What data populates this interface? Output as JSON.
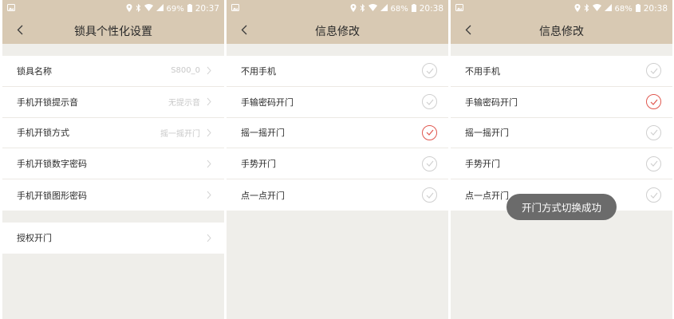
{
  "status_left": [
    {
      "battery": "69%",
      "time": "20:37"
    },
    {
      "battery": "68%",
      "time": "20:38"
    },
    {
      "battery": "68%",
      "time": "20:38"
    }
  ],
  "screen1": {
    "title": "锁具个性化设置",
    "items": [
      {
        "label": "锁具名称",
        "value": "S800_0"
      },
      {
        "label": "手机开锁提示音",
        "value": "无提示音"
      },
      {
        "label": "手机开锁方式",
        "value": "摇一摇开门"
      },
      {
        "label": "手机开锁数字密码",
        "value": ""
      },
      {
        "label": "手机开锁图形密码",
        "value": ""
      }
    ],
    "items2": [
      {
        "label": "授权开门",
        "value": ""
      }
    ]
  },
  "screen2": {
    "title": "信息修改",
    "items": [
      {
        "label": "不用手机",
        "checked": false
      },
      {
        "label": "手输密码开门",
        "checked": false
      },
      {
        "label": "摇一摇开门",
        "checked": true
      },
      {
        "label": "手势开门",
        "checked": false
      },
      {
        "label": "点一点开门",
        "checked": false
      }
    ]
  },
  "screen3": {
    "title": "信息修改",
    "items": [
      {
        "label": "不用手机",
        "checked": false
      },
      {
        "label": "手输密码开门",
        "checked": true
      },
      {
        "label": "摇一摇开门",
        "checked": false
      },
      {
        "label": "手势开门",
        "checked": false
      },
      {
        "label": "点一点开门",
        "checked": false
      }
    ],
    "toast": "开门方式切换成功"
  },
  "colors": {
    "accent": "#d8c9b3",
    "check_on": "#e0574f",
    "background": "#efeeea"
  }
}
